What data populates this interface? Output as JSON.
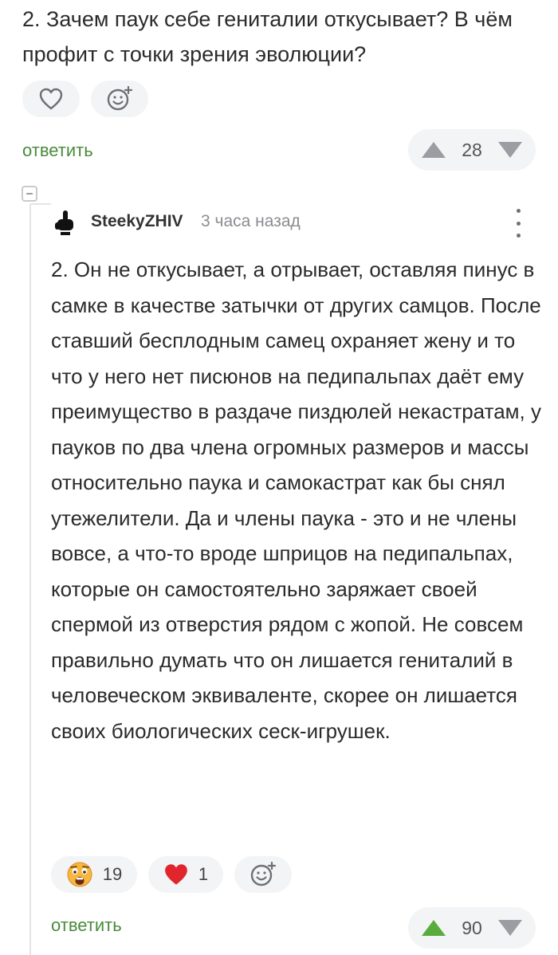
{
  "parent_comment": {
    "text": "2. Зачем паук себе гениталии откусывает? В чём профит с точки зрения эволюции?",
    "reply_label": "ответить",
    "rating": "28",
    "icons": [
      "heart-icon",
      "add-reaction-icon",
      "arrow-up-icon",
      "arrow-down-icon"
    ]
  },
  "reply_comment": {
    "author": "SteekyZHIV",
    "time": "3 часа назад",
    "text": "2. Он не откусывает, а отрывает, оставляя пинус в самке в качестве затычки от других самцов. После ставший бесплодным самец охраняет жену и то что у него нет писюнов на педипальпах даёт ему преимущество в раздаче пиздюлей некастратам, у пауков по два члена огромных размеров и массы относительно паука и самокастрат как бы снял утежелители. Да и члены паука - это и не члены вовсе, а что-то вроде шприцов на педипальпах, которые он самостоятельно заряжает своей спермой из отверстия рядом с жопой. Не совсем правильно думать что он лишается гениталий в человеческом эквиваленте, скорее он лишается своих биологических сеск-игрушек.",
    "reactions": [
      {
        "icon": "scared-face-icon",
        "count": "19"
      },
      {
        "icon": "heart-icon",
        "count": "1"
      }
    ],
    "reply_label": "ответить",
    "rating": "90",
    "icons": [
      "collapse-icon",
      "avatar-icon",
      "more-icon",
      "add-reaction-icon",
      "arrow-up-icon",
      "arrow-down-icon"
    ]
  },
  "colors": {
    "accent_green": "#4a8a3c",
    "vote_up_active": "#5aab3e",
    "vote_gray": "#9a9da1",
    "pill_bg": "#f3f4f5",
    "heart_red": "#e0262c"
  }
}
